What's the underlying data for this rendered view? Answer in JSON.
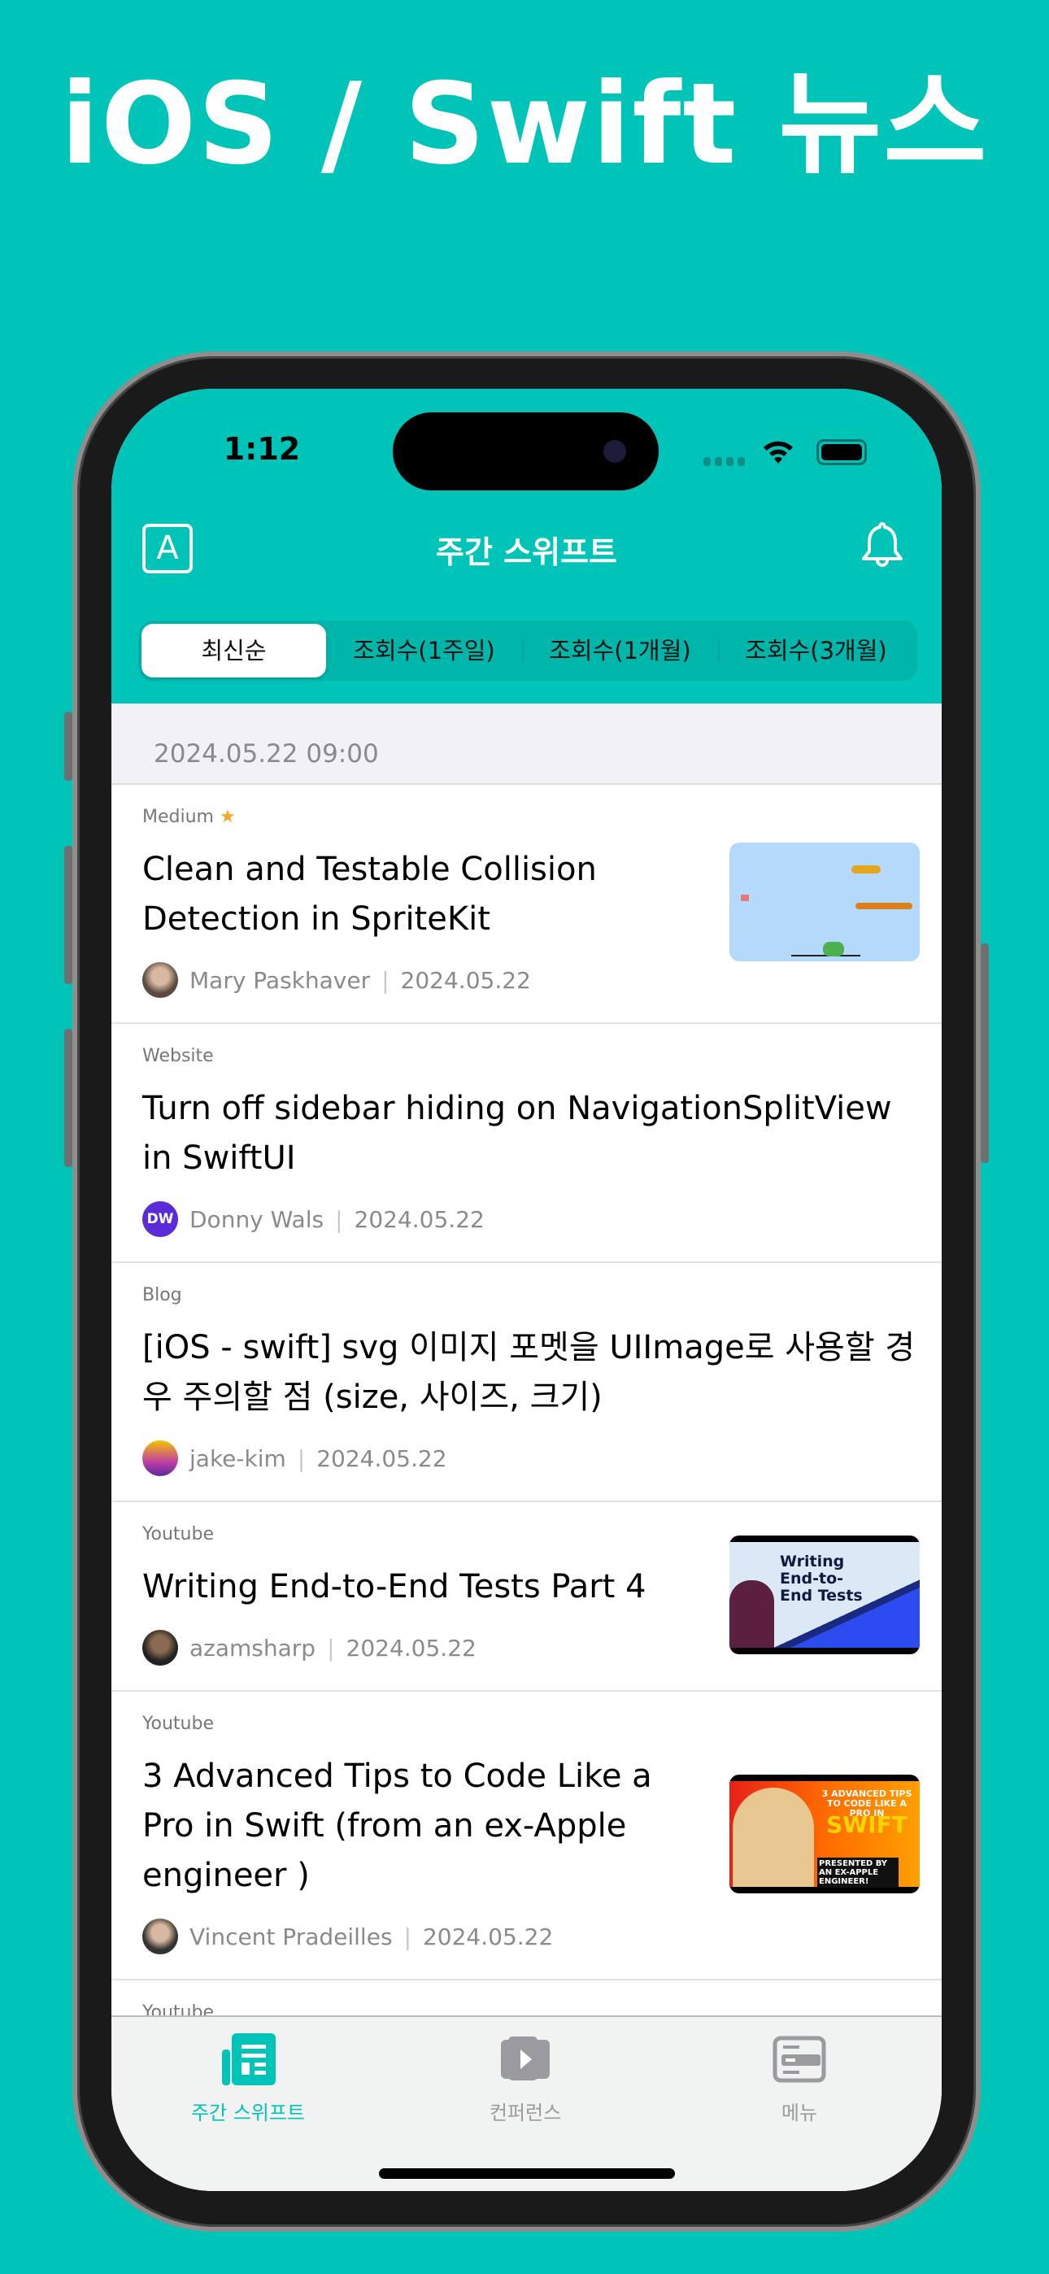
{
  "promo_title": "iOS / Swift 뉴스",
  "colors": {
    "brand": "#00C4B8",
    "background": "#00C4B8"
  },
  "status_bar": {
    "time": "1:12"
  },
  "nav": {
    "left_icon": "font-size-A-icon",
    "title": "주간 스위프트",
    "right_icon": "bell-icon"
  },
  "segments": [
    {
      "label": "최신순",
      "selected": true
    },
    {
      "label": "조회수(1주일)"
    },
    {
      "label": "조회수(1개월)"
    },
    {
      "label": "조회수(3개월)"
    }
  ],
  "date_header": "2024.05.22 09:00",
  "items": [
    {
      "source": "Medium",
      "starred": true,
      "title": "Clean and Testable Collision Detection in SpriteKit",
      "author": "Mary Paskhaver",
      "date": "2024.05.22",
      "thumbnail": "spritekit-game"
    },
    {
      "source": "Website",
      "title": "Turn off sidebar hiding on NavigationSplitView in SwiftUI",
      "author": "Donny Wals",
      "author_badge": "DW",
      "date": "2024.05.22"
    },
    {
      "source": "Blog",
      "title": "[iOS - swift] svg 이미지 포멧을 UIImage로 사용할 경우 주의할 점 (size, 사이즈, 크기)",
      "author": "jake-kim",
      "date": "2024.05.22"
    },
    {
      "source": "Youtube",
      "title": "Writing End-to-End Tests Part 4",
      "author": "azamsharp",
      "date": "2024.05.22",
      "thumbnail": "video",
      "thumb_text": "Writing End-to-End Tests"
    },
    {
      "source": "Youtube",
      "title": "3 Advanced Tips to Code Like a Pro in Swift (from an ex-Apple engineer )",
      "author": "Vincent Pradeilles",
      "date": "2024.05.22",
      "thumbnail": "video",
      "thumb_text": "3 ADVANCED TIPS TO CODE LIKE A PRO IN",
      "thumb_text2": "SWIFT",
      "thumb_text3": "PRESENTED BY AN EX-APPLE ENGINEER!"
    },
    {
      "source": "Youtube"
    }
  ],
  "tabbar": [
    {
      "label": "주간 스위프트",
      "icon": "newspaper-icon",
      "active": true
    },
    {
      "label": "컨퍼런스",
      "icon": "play-icon"
    },
    {
      "label": "메뉴",
      "icon": "menu-card-icon"
    }
  ]
}
